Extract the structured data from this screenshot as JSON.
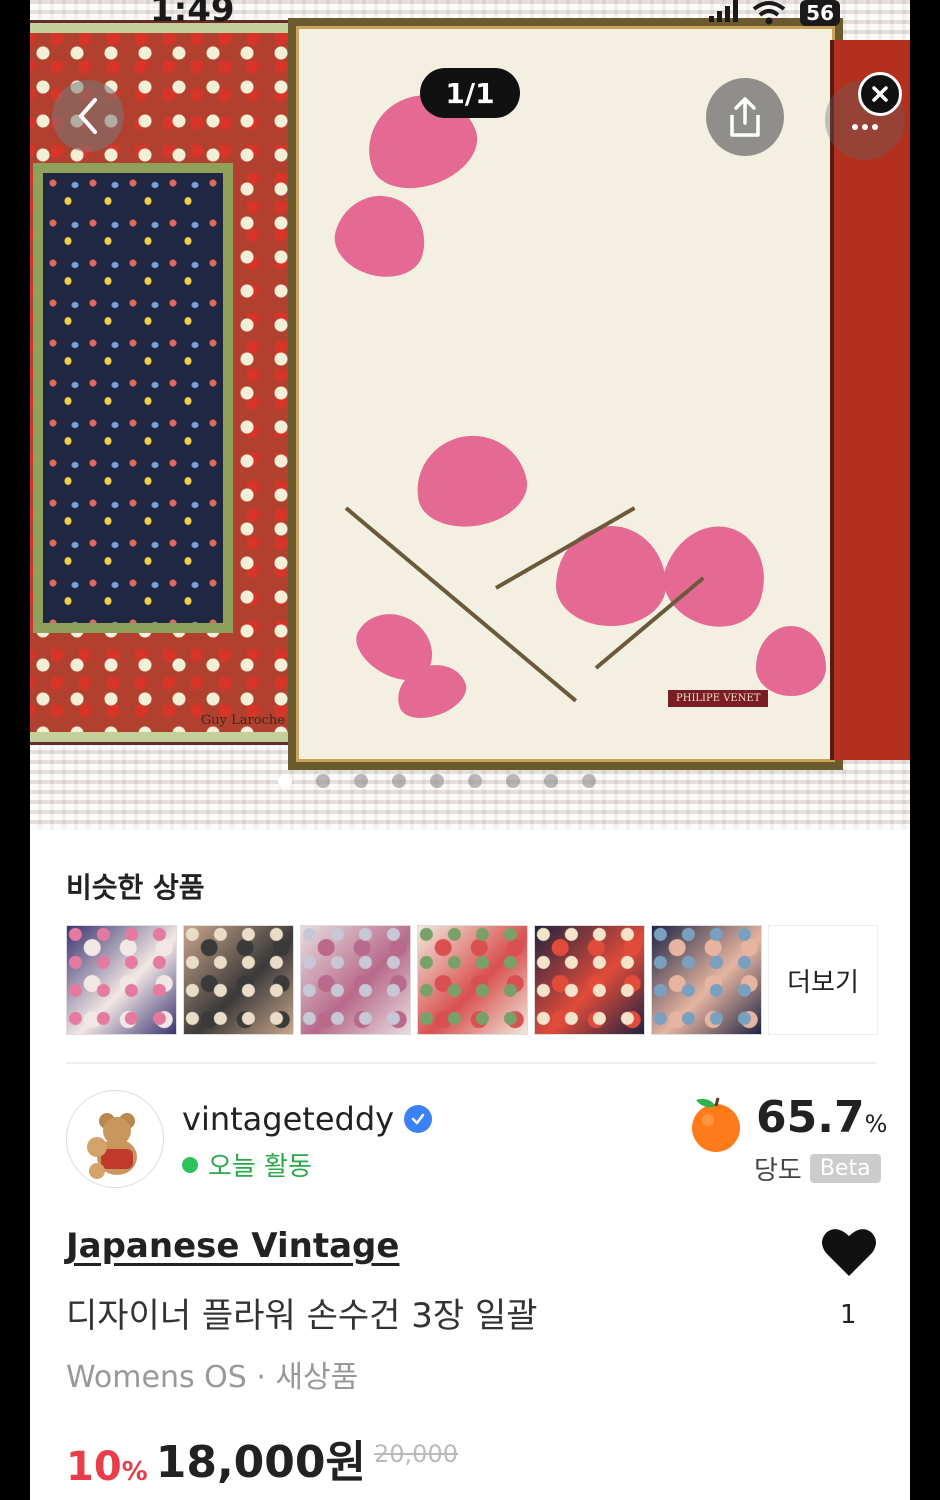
{
  "status_bar": {
    "time": "1:49",
    "battery": "56"
  },
  "viewer": {
    "counter": "1/1",
    "slide_count": 9,
    "active_slide": 1
  },
  "hero_image": {
    "left_brand": "Guy Laroche Paris",
    "middle_tag": "PHILIPE VENET"
  },
  "similar": {
    "title": "비슷한 상품",
    "more_label": "더보기",
    "thumbs": [
      {
        "name": "thumb-1",
        "colors": [
          "#3a3370",
          "#f1e7e4",
          "#e57aa0"
        ]
      },
      {
        "name": "thumb-2",
        "colors": [
          "#c9a58a",
          "#3b3a3a",
          "#e9ddc7"
        ]
      },
      {
        "name": "thumb-3",
        "colors": [
          "#e7dde0",
          "#b86a8a",
          "#c7c7d6"
        ]
      },
      {
        "name": "thumb-4",
        "colors": [
          "#f0e9dc",
          "#d95050",
          "#7aa06a"
        ]
      },
      {
        "name": "thumb-5",
        "colors": [
          "#1f2340",
          "#e04b3a",
          "#f4e2c9"
        ]
      },
      {
        "name": "thumb-6",
        "colors": [
          "#1d2544",
          "#e6b4a0",
          "#7aa0c0"
        ]
      }
    ]
  },
  "seller": {
    "name": "vintageteddy",
    "activity": "오늘 활동",
    "sweetness_value": "65.7",
    "sweetness_unit": "%",
    "sweetness_label": "당도",
    "beta": "Beta"
  },
  "product": {
    "brand": "Japanese Vintage",
    "title": "디자이너 플라워 손수건 3장 일괄",
    "meta": "Womens OS · 새상품",
    "likes": "1",
    "discount_value": "10",
    "discount_unit": "%",
    "price": "18,000원",
    "original_price": "20,000"
  },
  "colors": {
    "discount": "#ea3d4b",
    "activity": "#2aa84a",
    "verified": "#3b82f6"
  }
}
